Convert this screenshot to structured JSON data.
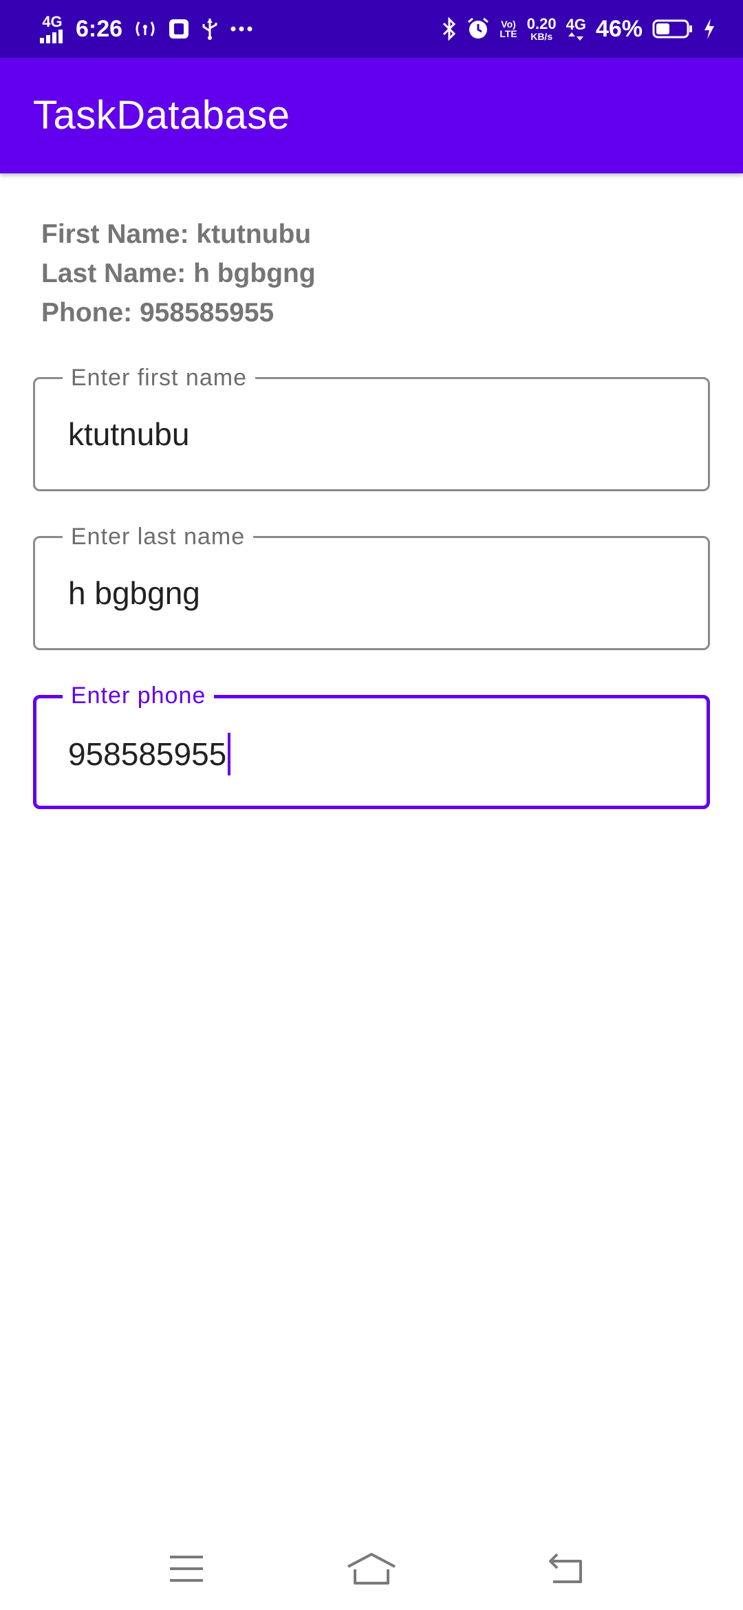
{
  "status_bar": {
    "network_left": "4G",
    "time": "6:26",
    "data_speed": "0.20",
    "data_speed_unit": "KB/s",
    "volte_top": "Vo)",
    "volte_bottom": "LTE",
    "network_right": "4G",
    "battery_percent": "46%",
    "battery_level": 0.46
  },
  "app_bar": {
    "title": "TaskDatabase",
    "color": "#6200EE"
  },
  "info": {
    "first_name_line": "First Name: ktutnubu",
    "last_name_line": "Last Name: h bgbgng",
    "phone_line": "Phone: 958585955"
  },
  "form": {
    "first_name": {
      "label": "Enter first name",
      "value": "ktutnubu"
    },
    "last_name": {
      "label": "Enter last name",
      "value": "h bgbgng"
    },
    "phone": {
      "label": "Enter phone",
      "value": "958585955",
      "focused": true
    }
  },
  "icons": {
    "menu": "menu-icon",
    "home": "home-icon",
    "back": "back-icon"
  }
}
